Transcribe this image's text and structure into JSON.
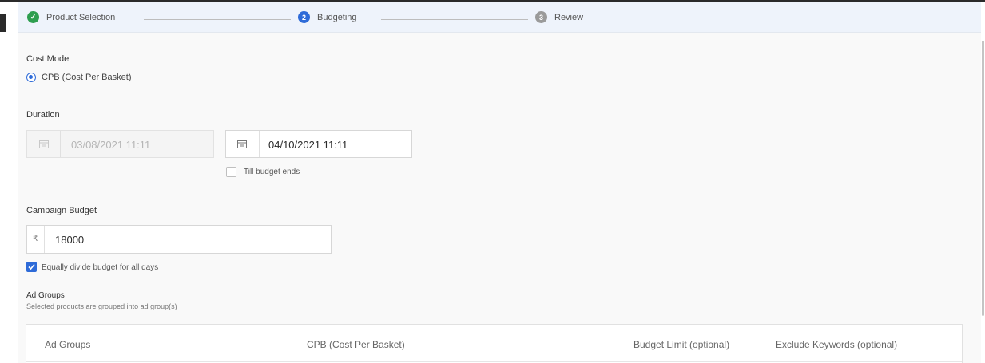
{
  "stepper": {
    "steps": [
      {
        "label": "Product Selection",
        "state": "done",
        "marker": "✓"
      },
      {
        "label": "Budgeting",
        "state": "active",
        "marker": "2"
      },
      {
        "label": "Review",
        "state": "todo",
        "marker": "3"
      }
    ]
  },
  "cost_model": {
    "label": "Cost Model",
    "option": "CPB (Cost Per Basket)",
    "selected": true
  },
  "duration": {
    "label": "Duration",
    "start_value": "03/08/2021 11:11",
    "end_value": "04/10/2021 11:11",
    "till_budget_ends": "Till budget ends"
  },
  "budget": {
    "label": "Campaign Budget",
    "currency": "₹",
    "value": "18000",
    "equally_divide": "Equally divide budget for all days"
  },
  "ad_groups": {
    "label": "Ad Groups",
    "description": "Selected products are grouped into ad group(s)",
    "columns": [
      "Ad Groups",
      "CPB (Cost Per Basket)",
      "Budget Limit (optional)",
      "Exclude Keywords (optional)"
    ]
  },
  "colors": {
    "accent": "#2e6bd8",
    "success": "#2e9e4f",
    "stepper_bg": "#eef3fb"
  }
}
